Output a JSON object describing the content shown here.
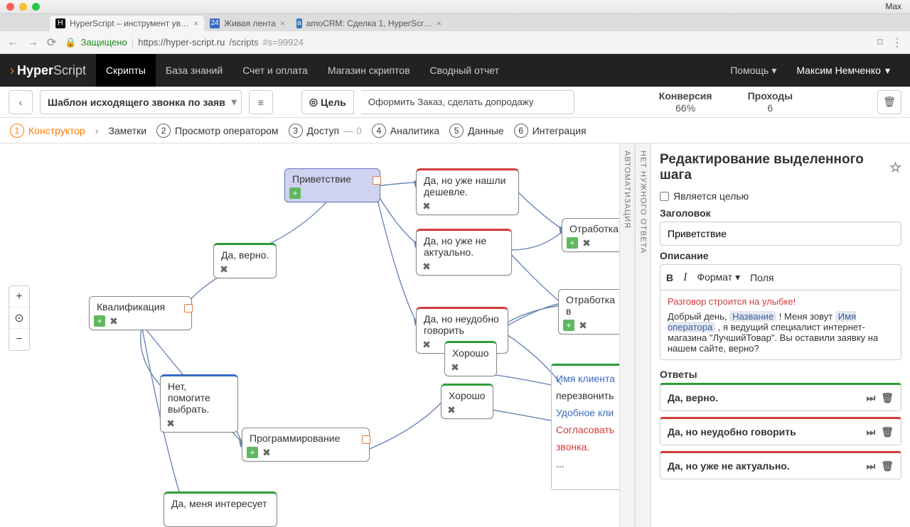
{
  "mac": {
    "user": "Max"
  },
  "tabs": [
    {
      "icon": "H",
      "title": "HyperScript – инструмент ув…",
      "active": true
    },
    {
      "icon": "24",
      "title": "Живая лента",
      "active": false
    },
    {
      "icon": "a",
      "title": "amoCRM: Сделка 1, HyperScr…",
      "active": false
    }
  ],
  "url": {
    "secure": "Защищено",
    "host": "https://hyper-script.ru",
    "path": "/scripts",
    "frag": "#s=99924"
  },
  "nav": {
    "brand_bold": "Hyper",
    "brand_light": "Script",
    "items": [
      "Скрипты",
      "База знаний",
      "Счет и оплата",
      "Магазин скриптов",
      "Сводный отчет"
    ],
    "help": "Помощь",
    "user": "Максим Немченко"
  },
  "toolbar": {
    "template": "Шаблон исходящего звонка по заяв",
    "goal_label": "Цель",
    "goal_value": "Оформить Заказ, сделать допродажу",
    "conv_label": "Конверсия",
    "conv_value": "66%",
    "pass_label": "Проходы",
    "pass_value": "6"
  },
  "steps": {
    "s1": "Конструктор",
    "notes": "Заметки",
    "s2": "Просмотр оператором",
    "s3": "Доступ",
    "s3_count": "0",
    "s4": "Аналитика",
    "s5": "Данные",
    "s6": "Интеграция"
  },
  "vbars": {
    "a": "АВТОМАТИЗАЦИЯ",
    "b": "НЕТ НУЖНОГО ОТВЕТА"
  },
  "nodes": {
    "greet": "Приветствие",
    "cheaper": "Да, но уже нашли дешевле.",
    "yes": "Да, верно.",
    "not_actual": "Да, но уже не актуально.",
    "otrab": "Отработка",
    "qual": "Квалификация",
    "inconv": "Да, но неудобно говорить",
    "good1": "Хорошо",
    "good2": "Хорошо",
    "otrab2": "Отработка в",
    "help_pick": "Нет, помогите выбрать.",
    "prog": "Программирование",
    "interest": "Да, меня интересует",
    "peek_client": "Имя клиента",
    "peek_callback": "перезвонить",
    "peek_convenient": "Удобное кли",
    "peek_agree": "Согласовать",
    "peek_call": "звонка.",
    "peek_dots": "..."
  },
  "editor": {
    "title": "Редактирование выделенного шага",
    "is_goal": "Является целью",
    "header_label": "Заголовок",
    "header_value": "Приветствие",
    "desc_label": "Описание",
    "format": "Формат",
    "fields": "Поля",
    "smile": "Разговор строится на улыбке!",
    "body_pre": "Добрый день, ",
    "body_tag1": "Название",
    "body_mid1": " ! Меня зовут ",
    "body_tag2": "Имя оператора",
    "body_post": " , я ведущий специалист интернет-магазина \"ЛучшийТовар\". Вы оставили заявку на нашем сайте, верно?",
    "answers_label": "Ответы",
    "answers": [
      "Да, верно.",
      "Да, но неудобно говорить",
      "Да, но уже не актуально."
    ]
  }
}
